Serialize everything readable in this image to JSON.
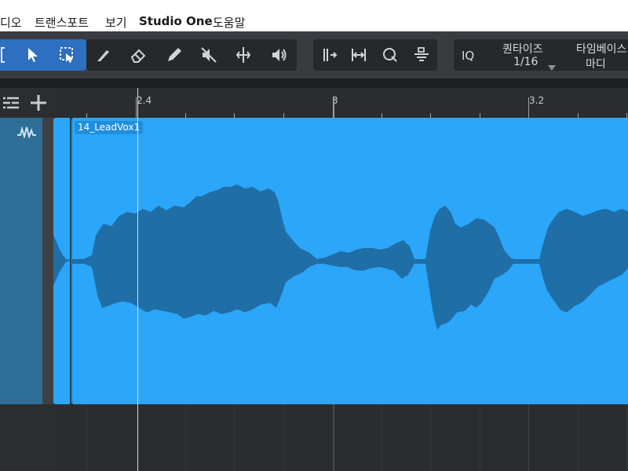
{
  "menubar": {
    "items": [
      "디오",
      "트랜스포트",
      "보기",
      "Studio One",
      "도움말"
    ]
  },
  "toolbar": {
    "quantize": {
      "label": "퀀타이즈",
      "value": "1/16"
    },
    "iq": "IQ",
    "timebase": {
      "label": "타임베이스",
      "value": "마디"
    }
  },
  "ruler": {
    "labels": [
      "2.4",
      "3",
      "3.2"
    ]
  },
  "event": {
    "name": "14_LeadVox1",
    "color": "#2ba6f9",
    "waveform_color": "#1f6ea6"
  },
  "colors": {
    "accent": "#2d6fc0",
    "background": "#2b2d31"
  }
}
